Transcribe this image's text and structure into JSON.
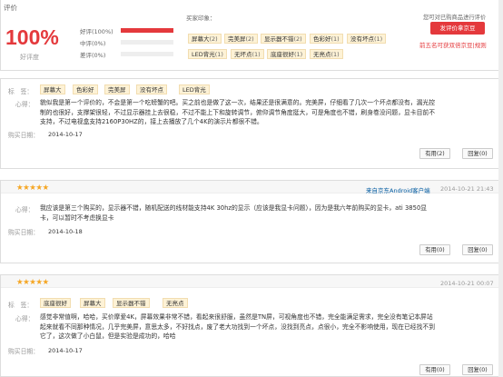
{
  "summary": {
    "title": "评价",
    "score": "100%",
    "score_label": "好评度",
    "rates": [
      {
        "label": "好评(100%)",
        "fill": 1.0
      },
      {
        "label": "中评(0%)",
        "fill": 0.0
      },
      {
        "label": "差评(0%)",
        "fill": 0.0
      }
    ],
    "impressions_title": "买家印象：",
    "tags": [
      {
        "name": "屏幕大",
        "count": "(2)"
      },
      {
        "name": "完美屏",
        "count": "(2)"
      },
      {
        "name": "显示器不错",
        "count": "(2)"
      },
      {
        "name": "色彩好",
        "count": "(1)"
      },
      {
        "name": "没有坏点",
        "count": "(1)"
      },
      {
        "name": "LED背光",
        "count": "(1)"
      },
      {
        "name": "无坏点",
        "count": "(1)"
      },
      {
        "name": "底座很好",
        "count": "(1)"
      },
      {
        "name": "无亮点",
        "count": "(1)"
      }
    ],
    "side_hint": "您可对已购商品进行评价",
    "post_button": "发评价拿京豆",
    "reward_link": "前五名可获双倍京豆|规则"
  },
  "comments": [
    {
      "tags_label": "标　签：",
      "tags": [
        "屏幕大",
        "色彩好",
        "完美屏",
        "没有坏点",
        "LED背光"
      ],
      "heart_label": "心得：",
      "text_lines": [
        "貌似我是第一个评价的，不会是第一个吃螃蟹的吧。买之前也是做了这一次，结果还是很满意的。完美屏，仔细看了几次一个坏点都没有，漏光控",
        "制的也很好，支撑架很轻，不过显示器挂上去很稳，不过不能上下和旋转调节，俯仰调节角度挺大，可是角度也不错，刷身卷没问题，显卡目前不",
        "支持，不过电视盒支持2160P30HZ的，接上去播放了几个4K的演示片都很不错。"
      ],
      "date_label": "购买日期：",
      "date": "2014-10-17",
      "useful": "有用(2)",
      "reply": "回复(0)"
    },
    {
      "stars": "★★★★★",
      "device": "来自京东Android客户端",
      "time": "2014-10-21 21:43",
      "heart_label": "心得：",
      "text_lines": [
        "我应该是第三个购买的，显示器不错，随机配送的线材能支持4K 30hz的显示（应该是我显卡问题），因为是我六年前购买的显卡，ati 3850显",
        "卡，可以暂时不考虑换显卡"
      ],
      "date_label": "购买日期：",
      "date": "2014-10-18",
      "useful": "有用(0)",
      "reply": "回复(0)"
    },
    {
      "stars": "★★★★★",
      "time": "2014-10-21 00:07",
      "tags_label": "标　签：",
      "tags": [
        "底座很好",
        "屏幕大",
        "显示器不错",
        "无亮点"
      ],
      "heart_label": "心得：",
      "text_lines": [
        "感觉非常值啊，哈哈，买价摩爱4K，屏幕效果非常不错，看起来很舒服，虽然是TN屏，可视角度也不错，完全能满足需求，完全没有笔记本屏站",
        "起来就看不同那种情况，几乎完美屏，意思太多，不好找点，废了老大功找到一个坏点，没找到亮点，点很小，完全不影响使用，现在已经找不到",
        "它了，这次做了小白鼠，但是实验是成功的，哈哈"
      ],
      "date_label": "购买日期：",
      "date": "2014-10-17",
      "useful": "有用(0)",
      "reply": "回复(0)"
    }
  ]
}
